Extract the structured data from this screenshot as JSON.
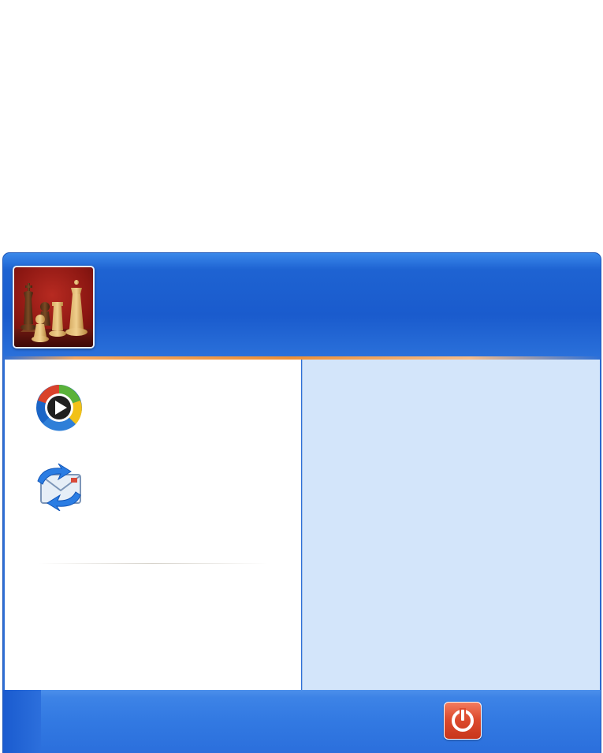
{
  "header": {
    "user_name": ""
  },
  "pinned_programs": [
    {
      "icon": "windows-media-player-icon",
      "label": ""
    },
    {
      "icon": "outlook-express-icon",
      "label": ""
    }
  ],
  "all_programs_label": "",
  "right_pane": {
    "items": []
  },
  "footer": {
    "turn_off_icon": "power-icon",
    "turn_off_label": ""
  },
  "colors": {
    "header_blue": "#1a5bcd",
    "accent_orange": "#ec8f36",
    "right_pane_blue": "#d3e5fa",
    "footer_blue": "#3279e2",
    "power_red": "#dd4b2e"
  }
}
